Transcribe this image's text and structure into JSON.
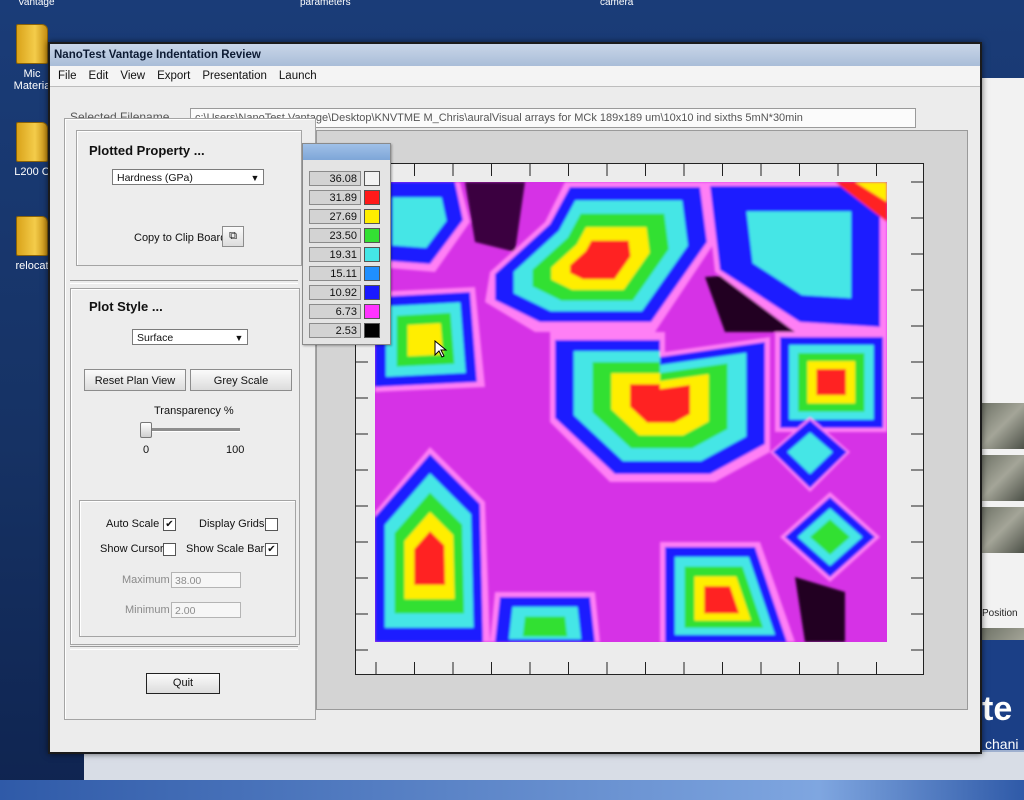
{
  "desktop": {
    "top_labels": [
      "Vantage",
      "parameters",
      "camera"
    ],
    "icons": [
      {
        "label_line1": "Mic",
        "label_line2": "Materia"
      },
      {
        "label_line1": "L200 C",
        "label_line2": ""
      },
      {
        "label_line1": "relocat",
        "label_line2": ""
      }
    ],
    "right_panel": {
      "position_label": "Position",
      "brand_text": "te",
      "brand_sub": "chani"
    }
  },
  "window": {
    "title": "NanoTest Vantage Indentation Review",
    "menu": [
      "File",
      "Edit",
      "View",
      "Export",
      "Presentation",
      "Launch"
    ],
    "filename_label": "Selected Filename",
    "filename_value": "c:\\Users\\NanoTest Vantage\\Desktop\\KNVTME M_Chris\\auralVisual arrays for MCk 189x189 um\\10x10 ind sixths 5mN*30min"
  },
  "plotted_property": {
    "heading": "Plotted Property ...",
    "selected": "Hardness (GPa)",
    "copy_label": "Copy to Clip Board"
  },
  "plot_style": {
    "heading": "Plot Style ...",
    "selected": "Surface",
    "reset_button": "Reset Plan View",
    "grey_button": "Grey Scale",
    "transparency_label": "Transparency %",
    "slider_min": "0",
    "slider_max": "100",
    "transparency_value": 0
  },
  "options": {
    "auto_scale": {
      "label": "Auto Scale",
      "checked": true
    },
    "display_grids": {
      "label": "Display Grids",
      "checked": false
    },
    "show_cursor": {
      "label": "Show Cursor",
      "checked": false
    },
    "show_scale_bar": {
      "label": "Show Scale Bar",
      "checked": true
    },
    "maximum_label": "Maximum",
    "maximum_value": "38.00",
    "minimum_label": "Minimum",
    "minimum_value": "2.00"
  },
  "quit_label": "Quit",
  "legend": [
    {
      "value": "36.08",
      "color": "#f2f2f2"
    },
    {
      "value": "31.89",
      "color": "#ff1a1a"
    },
    {
      "value": "27.69",
      "color": "#ffee00"
    },
    {
      "value": "23.50",
      "color": "#33e033"
    },
    {
      "value": "19.31",
      "color": "#44e6e6"
    },
    {
      "value": "15.11",
      "color": "#1f8fff"
    },
    {
      "value": "10.92",
      "color": "#1a1aff"
    },
    {
      "value": "6.73",
      "color": "#ff33ff"
    },
    {
      "value": "2.53",
      "color": "#000000"
    }
  ],
  "colors": {
    "background_magenta": "#d632e6",
    "red": "#ff2222",
    "yellow": "#ffee00",
    "green": "#33e033",
    "cyan": "#44e6e6",
    "blue": "#1a1aff",
    "black": "#0a0010"
  }
}
